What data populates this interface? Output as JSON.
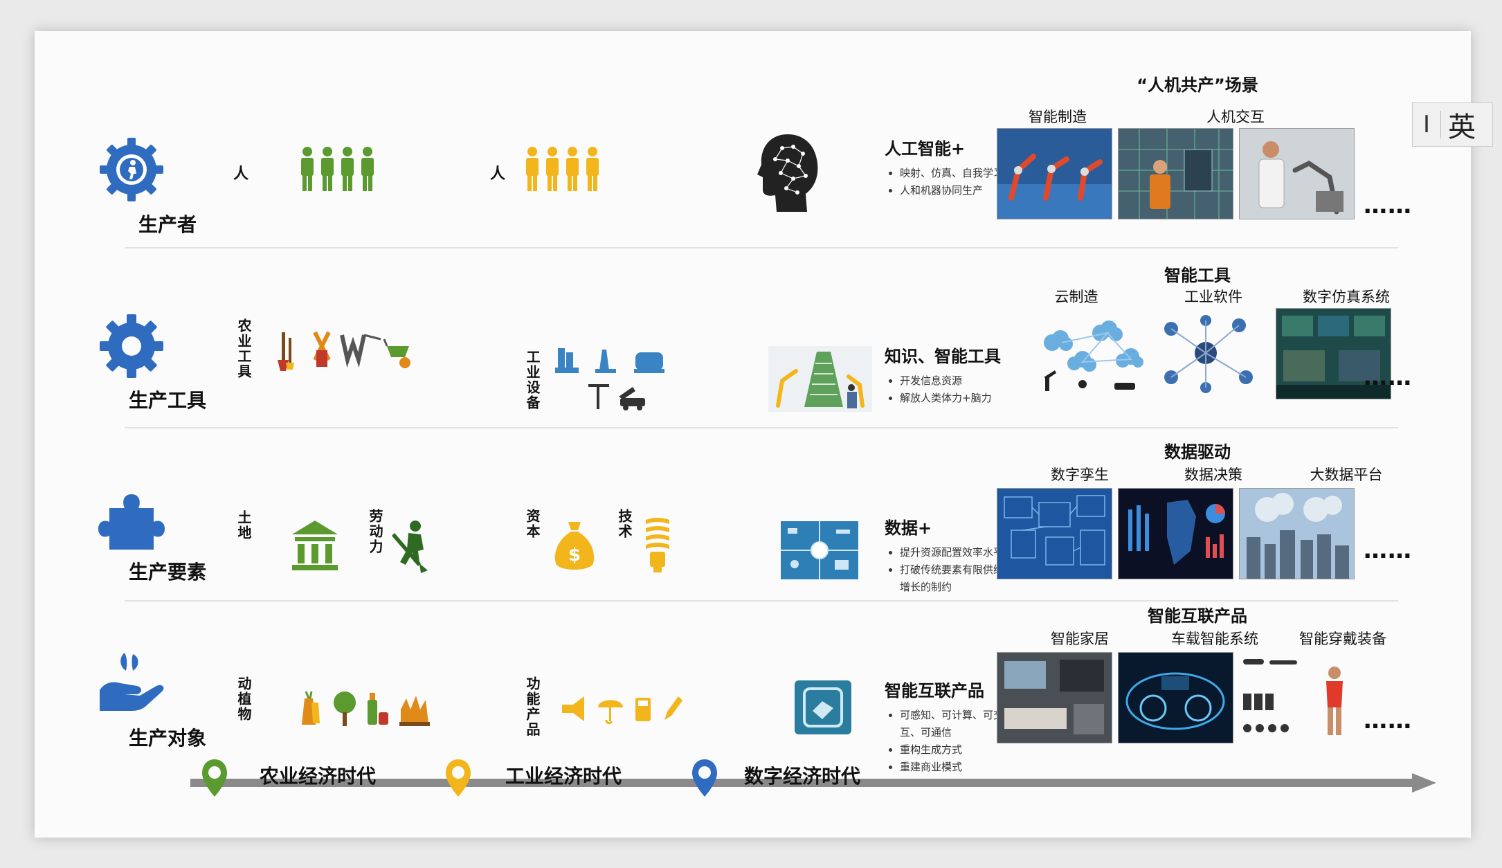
{
  "scene_title": "“人机共产”场景",
  "ime": {
    "cursor": "I",
    "mode": "英"
  },
  "rows": [
    {
      "label": "生产者",
      "agri_text": "人",
      "ind_text": "人",
      "digital": {
        "title": "人工智能+",
        "bullets": [
          "映射、仿真、自我学习",
          "人和机器协同生产"
        ]
      },
      "group_title": "",
      "thumbs": [
        "智能制造",
        "人机交互"
      ]
    },
    {
      "label": "生产工具",
      "agri_text": "农业工具",
      "ind_text": "工业设备",
      "digital": {
        "title": "知识、智能工具",
        "bullets": [
          "开发信息资源",
          "解放人类体力+脑力"
        ]
      },
      "group_title": "智能工具",
      "thumbs": [
        "云制造",
        "工业软件",
        "数字仿真系统"
      ]
    },
    {
      "label": "生产要素",
      "agri_text": [
        "土地",
        "劳动力"
      ],
      "ind_text": [
        "资本",
        "技术"
      ],
      "digital": {
        "title": "数据+",
        "bullets": [
          "提升资源配置效率水平",
          "打破传统要素有限供给对增长的制约"
        ]
      },
      "group_title": "数据驱动",
      "thumbs": [
        "数字孪生",
        "数据决策",
        "大数据平台"
      ]
    },
    {
      "label": "生产对象",
      "agri_text": "动植物",
      "ind_text": "功能产品",
      "digital": {
        "title": "智能互联产品",
        "bullets": [
          "可感知、可计算、可交互、可通信",
          "重构生成方式",
          "重建商业模式"
        ]
      },
      "group_title": "智能互联产品",
      "thumbs": [
        "智能家居",
        "车载智能系统",
        "智能穿戴装备"
      ]
    }
  ],
  "more": "……",
  "eras": [
    "农业经济时代",
    "工业经济时代",
    "数字经济时代"
  ],
  "colors": {
    "blue": "#2f6cc0",
    "green": "#5a9a2e",
    "yellow": "#f2b51c",
    "dark": "#3b3b3b"
  }
}
